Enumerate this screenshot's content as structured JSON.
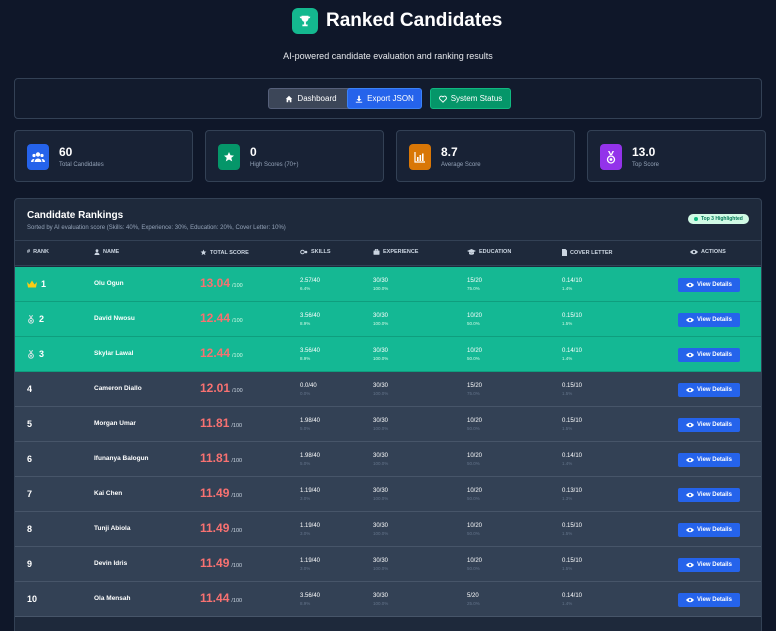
{
  "header": {
    "title": "Ranked Candidates",
    "subtitle": "AI-powered candidate evaluation and ranking results"
  },
  "toolbar": {
    "dashboard_label": "Dashboard",
    "export_label": "Export JSON",
    "status_label": "System Status"
  },
  "stats": [
    {
      "value": "60",
      "label": "Total Candidates",
      "icon": "users-icon",
      "color": "#2563eb"
    },
    {
      "value": "0",
      "label": "High Scores (70+)",
      "icon": "star-icon",
      "color": "#059669"
    },
    {
      "value": "8.7",
      "label": "Average Score",
      "icon": "chart-icon",
      "color": "#d97706"
    },
    {
      "value": "13.0",
      "label": "Top Score",
      "icon": "medal-icon",
      "color": "#9333ea"
    }
  ],
  "rankings": {
    "title": "Candidate Rankings",
    "subtitle": "Sorted by AI evaluation score (Skills: 40%, Experience: 30%, Education: 20%, Cover Letter: 10%)",
    "badge": "Top 3 Highlighted",
    "columns": {
      "rank": "RANK",
      "name": "NAME",
      "total": "TOTAL SCORE",
      "skills": "SKILLS",
      "experience": "EXPERIENCE",
      "education": "EDUCATION",
      "cover": "COVER LETTER",
      "actions": "ACTIONS"
    },
    "view_label": "View Details",
    "rows": [
      {
        "rank": "1",
        "name": "Olu Ogun",
        "score": "13.04",
        "denom": "/100",
        "skills": "2.57/40",
        "skills_pct": "6.4%",
        "exp": "30/30",
        "exp_pct": "100.0%",
        "edu": "15/20",
        "edu_pct": "75.0%",
        "cov": "0.14/10",
        "cov_pct": "1.4%"
      },
      {
        "rank": "2",
        "name": "David Nwosu",
        "score": "12.44",
        "denom": "/100",
        "skills": "3.56/40",
        "skills_pct": "8.9%",
        "exp": "30/30",
        "exp_pct": "100.0%",
        "edu": "10/20",
        "edu_pct": "50.0%",
        "cov": "0.15/10",
        "cov_pct": "1.5%"
      },
      {
        "rank": "3",
        "name": "Skylar Lawal",
        "score": "12.44",
        "denom": "/100",
        "skills": "3.56/40",
        "skills_pct": "8.9%",
        "exp": "30/30",
        "exp_pct": "100.0%",
        "edu": "10/20",
        "edu_pct": "50.0%",
        "cov": "0.14/10",
        "cov_pct": "1.4%"
      },
      {
        "rank": "4",
        "name": "Cameron Diallo",
        "score": "12.01",
        "denom": "/100",
        "skills": "0.0/40",
        "skills_pct": "0.0%",
        "exp": "30/30",
        "exp_pct": "100.0%",
        "edu": "15/20",
        "edu_pct": "75.0%",
        "cov": "0.15/10",
        "cov_pct": "1.5%"
      },
      {
        "rank": "5",
        "name": "Morgan Umar",
        "score": "11.81",
        "denom": "/100",
        "skills": "1.98/40",
        "skills_pct": "5.0%",
        "exp": "30/30",
        "exp_pct": "100.0%",
        "edu": "10/20",
        "edu_pct": "50.0%",
        "cov": "0.15/10",
        "cov_pct": "1.5%"
      },
      {
        "rank": "6",
        "name": "Ifunanya Balogun",
        "score": "11.81",
        "denom": "/100",
        "skills": "1.98/40",
        "skills_pct": "5.0%",
        "exp": "30/30",
        "exp_pct": "100.0%",
        "edu": "10/20",
        "edu_pct": "50.0%",
        "cov": "0.14/10",
        "cov_pct": "1.4%"
      },
      {
        "rank": "7",
        "name": "Kai Chen",
        "score": "11.49",
        "denom": "/100",
        "skills": "1.19/40",
        "skills_pct": "3.0%",
        "exp": "30/30",
        "exp_pct": "100.0%",
        "edu": "10/20",
        "edu_pct": "50.0%",
        "cov": "0.13/10",
        "cov_pct": "1.3%"
      },
      {
        "rank": "8",
        "name": "Tunji Abiola",
        "score": "11.49",
        "denom": "/100",
        "skills": "1.19/40",
        "skills_pct": "3.0%",
        "exp": "30/30",
        "exp_pct": "100.0%",
        "edu": "10/20",
        "edu_pct": "50.0%",
        "cov": "0.15/10",
        "cov_pct": "1.5%"
      },
      {
        "rank": "9",
        "name": "Devin Idris",
        "score": "11.49",
        "denom": "/100",
        "skills": "1.19/40",
        "skills_pct": "3.0%",
        "exp": "30/30",
        "exp_pct": "100.0%",
        "edu": "10/20",
        "edu_pct": "50.0%",
        "cov": "0.15/10",
        "cov_pct": "1.5%"
      },
      {
        "rank": "10",
        "name": "Ola Mensah",
        "score": "11.44",
        "denom": "/100",
        "skills": "3.56/40",
        "skills_pct": "8.9%",
        "exp": "30/30",
        "exp_pct": "100.0%",
        "edu": "5/20",
        "edu_pct": "25.0%",
        "cov": "0.14/10",
        "cov_pct": "1.4%"
      }
    ]
  }
}
